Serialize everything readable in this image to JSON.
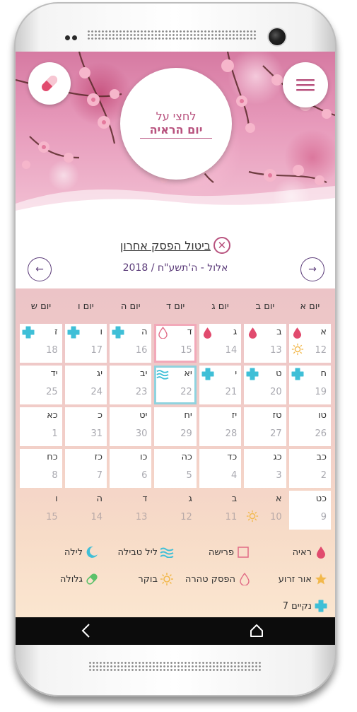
{
  "header": {
    "center_line1": "לחצי על",
    "center_line2": "יום הראיה"
  },
  "cancel": {
    "label": "ביטול הפסק אחרון"
  },
  "month_nav": {
    "month": "אלול",
    "separator": " - ",
    "hebrew_year": "ה'תשע\"ח",
    "slash": " / ",
    "gregorian_year": "2018"
  },
  "weekdays": [
    "יום א",
    "יום ב",
    "יום ג",
    "יום ד",
    "יום ה",
    "יום ו",
    "יום ש"
  ],
  "weeks": [
    [
      {
        "heb": "א",
        "greg": "12",
        "icons": [
          "drop-red",
          "sun"
        ]
      },
      {
        "heb": "ב",
        "greg": "13",
        "icons": [
          "drop-red"
        ]
      },
      {
        "heb": "ג",
        "greg": "14",
        "icons": [
          "drop-red"
        ]
      },
      {
        "heb": "ד",
        "greg": "15",
        "icons": [
          "drop-outline"
        ],
        "highlight": "pink"
      },
      {
        "heb": "ה",
        "greg": "16",
        "icons": [
          "cross"
        ]
      },
      {
        "heb": "ו",
        "greg": "17",
        "icons": [
          "cross"
        ]
      },
      {
        "heb": "ז",
        "greg": "18",
        "icons": [
          "cross"
        ]
      }
    ],
    [
      {
        "heb": "ח",
        "greg": "19",
        "icons": [
          "cross"
        ]
      },
      {
        "heb": "ט",
        "greg": "20",
        "icons": [
          "cross"
        ]
      },
      {
        "heb": "י",
        "greg": "21",
        "icons": [
          "cross"
        ]
      },
      {
        "heb": "יא",
        "greg": "22",
        "icons": [
          "waves"
        ],
        "highlight": "teal"
      },
      {
        "heb": "יב",
        "greg": "23",
        "icons": []
      },
      {
        "heb": "יג",
        "greg": "24",
        "icons": []
      },
      {
        "heb": "יד",
        "greg": "25",
        "icons": []
      }
    ],
    [
      {
        "heb": "טו",
        "greg": "26",
        "icons": []
      },
      {
        "heb": "טז",
        "greg": "27",
        "icons": []
      },
      {
        "heb": "יז",
        "greg": "28",
        "icons": []
      },
      {
        "heb": "יח",
        "greg": "29",
        "icons": []
      },
      {
        "heb": "יט",
        "greg": "30",
        "icons": []
      },
      {
        "heb": "כ",
        "greg": "31",
        "icons": []
      },
      {
        "heb": "כא",
        "greg": "1",
        "icons": []
      }
    ],
    [
      {
        "heb": "כב",
        "greg": "2",
        "icons": []
      },
      {
        "heb": "כג",
        "greg": "3",
        "icons": []
      },
      {
        "heb": "כד",
        "greg": "4",
        "icons": []
      },
      {
        "heb": "כה",
        "greg": "5",
        "icons": []
      },
      {
        "heb": "כו",
        "greg": "6",
        "icons": []
      },
      {
        "heb": "כז",
        "greg": "7",
        "icons": []
      },
      {
        "heb": "כח",
        "greg": "8",
        "icons": []
      }
    ],
    [
      {
        "heb": "כט",
        "greg": "9",
        "icons": []
      },
      {
        "heb": "א",
        "greg": "10",
        "icons": [
          "sun"
        ],
        "outside": true
      },
      {
        "heb": "ב",
        "greg": "11",
        "icons": [],
        "outside": true
      },
      {
        "heb": "ג",
        "greg": "12",
        "icons": [],
        "outside": true
      },
      {
        "heb": "ד",
        "greg": "13",
        "icons": [],
        "outside": true
      },
      {
        "heb": "ה",
        "greg": "14",
        "icons": [],
        "outside": true
      },
      {
        "heb": "ו",
        "greg": "15",
        "icons": [],
        "outside": true
      }
    ]
  ],
  "legend": {
    "seeing": "ראיה",
    "separation": "פרישה",
    "immersion_night": "ליל טבילה",
    "night": "לילה",
    "dawn": "אור זרוע",
    "hefsek": "הפסק טהרה",
    "morning": "בוקר",
    "pill": "גלולה",
    "clean7": "נקיים 7"
  },
  "colors": {
    "accent": "#b8527e",
    "drop_red": "#e14b6e",
    "cross_teal": "#3fbfd7",
    "sun": "#f2b84b",
    "nav_text": "#5a3a78"
  }
}
